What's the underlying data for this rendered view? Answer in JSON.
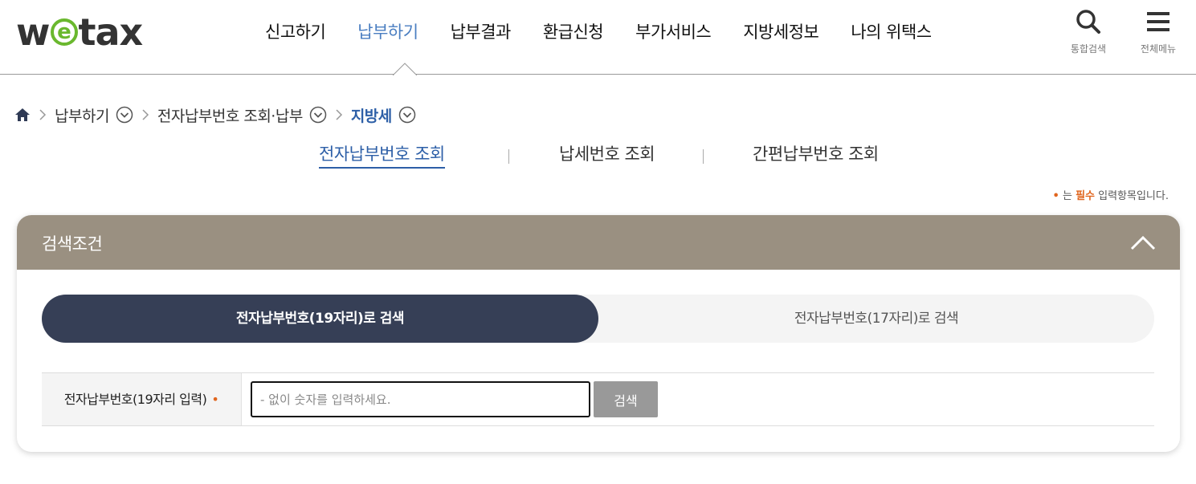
{
  "header": {
    "logo": {
      "w": "w",
      "e": "e",
      "tax": "tax"
    },
    "nav": [
      "신고하기",
      "납부하기",
      "납부결과",
      "환급신청",
      "부가서비스",
      "지방세정보",
      "나의 위택스"
    ],
    "active_nav_index": 1,
    "utils": {
      "search_label": "통합검색",
      "menu_label": "전체메뉴"
    }
  },
  "breadcrumb": {
    "items": [
      "납부하기",
      "전자납부번호 조회·납부",
      "지방세"
    ]
  },
  "subtabs": {
    "items": [
      "전자납부번호 조회",
      "납세번호 조회",
      "간편납부번호 조회"
    ],
    "active_index": 0
  },
  "required_note": {
    "dot": "•",
    "prefix": " 는 ",
    "must": "필수",
    "suffix": " 입력항목입니다."
  },
  "panel": {
    "title": "검색조건",
    "tabs": [
      "전자납부번호(19자리)로 검색",
      "전자납부번호(17자리)로 검색"
    ],
    "active_tab_index": 0,
    "field": {
      "label": "전자납부번호(19자리 입력)",
      "required_mark": "•",
      "placeholder": "- 없이 숫자를 입력하세요.",
      "value": ""
    },
    "search_button": "검색"
  },
  "colors": {
    "accent": "#4a7ec1",
    "breadcrumb_current": "#2d5fa7",
    "panel_header": "#9a9081",
    "active_tab": "#363f56",
    "required": "#e0651e",
    "logo_green": "#6ab82e"
  }
}
